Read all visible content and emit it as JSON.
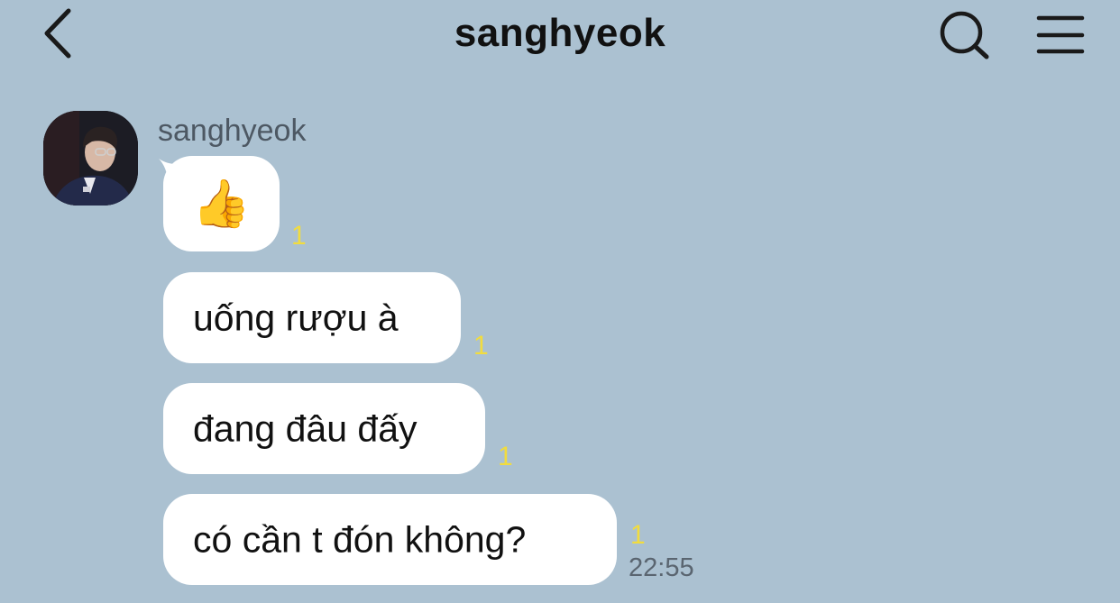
{
  "header": {
    "title": "sanghyeok",
    "back_icon": "chevron-left-icon",
    "search_icon": "search-icon",
    "menu_icon": "hamburger-menu-icon"
  },
  "sender": {
    "name": "sanghyeok",
    "avatar": "profile-avatar"
  },
  "messages": [
    {
      "text": "👍",
      "unread": "1"
    },
    {
      "text": "uống rượu à",
      "unread": "1"
    },
    {
      "text": "đang đâu đấy",
      "unread": "1"
    },
    {
      "text": "có cần t đón không?",
      "unread": "1"
    }
  ],
  "last_time": "22:55",
  "colors": {
    "background": "#abc1d1",
    "bubble": "#ffffff",
    "unread": "#f1dc3f"
  }
}
